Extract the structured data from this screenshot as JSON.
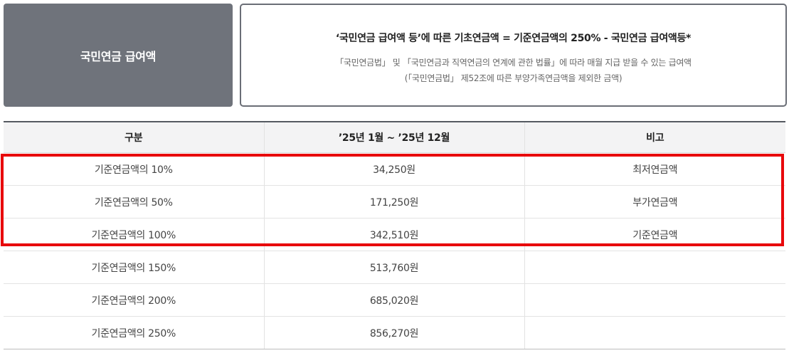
{
  "label_box": {
    "title": "국민연금 급여액"
  },
  "formula": {
    "main": "‘국민연금 급여액 등’에 따른 기초연금액 = 기준연금액의 250% - 국민연금 급여액등*",
    "sub_line1": "「국민연금법」 및 「국민연금과 직역연금의 연계에 관한 법률」에 따라 매월 지급 받을 수 있는 급여액",
    "sub_line2": "(「국민연금법」 제52조에 따른 부양가족연금액을 제외한 금액)"
  },
  "table": {
    "headers": [
      "구분",
      "’25년 1월 ~ ’25년 12월",
      "비고"
    ],
    "rows": [
      {
        "category": "기준연금액의 10%",
        "amount": "34,250원",
        "note": "최저연금액"
      },
      {
        "category": "기준연금액의 50%",
        "amount": "171,250원",
        "note": "부가연금액"
      },
      {
        "category": "기준연금액의 100%",
        "amount": "342,510원",
        "note": "기준연금액"
      },
      {
        "category": "기준연금액의 150%",
        "amount": "513,760원",
        "note": ""
      },
      {
        "category": "기준연금액의 200%",
        "amount": "685,020원",
        "note": ""
      },
      {
        "category": "기준연금액의 250%",
        "amount": "856,270원",
        "note": ""
      }
    ]
  },
  "highlight": {
    "color": "#e8080b",
    "rows_covered": [
      "기준연금액의 10%",
      "기준연금액의 50%",
      "기준연금액의 100%"
    ]
  }
}
